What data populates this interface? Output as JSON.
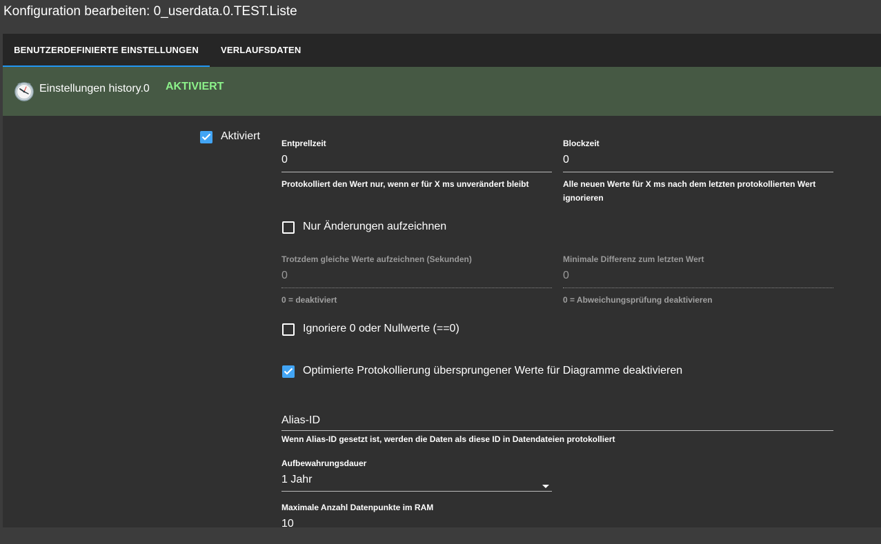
{
  "window": {
    "title": "Konfiguration bearbeiten: 0_userdata.0.TEST.Liste"
  },
  "tabs": [
    {
      "label": "BENUTZERDEFINIERTE EINSTELLUNGEN",
      "active": true
    },
    {
      "label": "VERLAUFSDATEN",
      "active": false
    }
  ],
  "header": {
    "icon": "clock-icon",
    "text": "Einstellungen history.0",
    "status": "AKTIVIERT",
    "status_color": "#8cf28a",
    "background": "#465944"
  },
  "enabled": {
    "label": "Aktiviert",
    "checked": true
  },
  "debounce": {
    "label": "Entprellzeit",
    "value": "0",
    "help": "Protokolliert den Wert nur, wenn er für X ms unverändert bleibt"
  },
  "blocktime": {
    "label": "Blockzeit",
    "value": "0",
    "help_line1": "Alle neuen Werte für X ms nach dem letzten protokollierten Wert",
    "help_line2": "ignorieren"
  },
  "changes_only": {
    "label": "Nur Änderungen aufzeichnen",
    "checked": false
  },
  "same_values": {
    "label": "Trotzdem gleiche Werte aufzeichnen (Sekunden)",
    "value": "0",
    "help": "0 = deaktiviert"
  },
  "min_difference": {
    "label": "Minimale Differenz zum letzten Wert",
    "value": "0",
    "help": "0 = Abweichungsprüfung deaktivieren"
  },
  "ignore_zero": {
    "label": "Ignoriere 0 oder Nullwerte (==0)",
    "checked": false
  },
  "disable_skipped": {
    "label": "Optimierte Protokollierung übersprungener Werte für Diagramme deaktivieren",
    "checked": true
  },
  "alias": {
    "label": "Alias-ID",
    "help": "Wenn Alias-ID gesetzt ist, werden die Daten als diese ID in Datendateien protokolliert"
  },
  "retention": {
    "label": "Aufbewahrungsdauer",
    "value": "1 Jahr"
  },
  "max_ram": {
    "label": "Maximale Anzahl Datenpunkte im RAM",
    "value": "10"
  },
  "colors": {
    "accent": "#2196f3",
    "checkbox": "#42a5f5"
  }
}
